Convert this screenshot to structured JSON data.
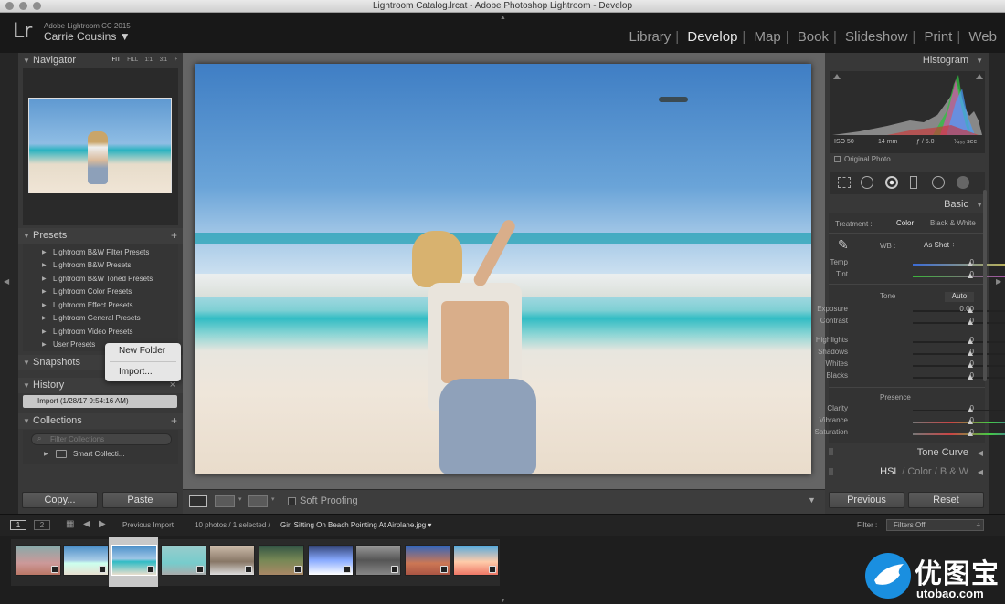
{
  "window": {
    "title": "Lightroom Catalog.lrcat - Adobe Photoshop Lightroom - Develop"
  },
  "identity": {
    "logo": "Lr",
    "product": "Adobe Lightroom CC 2015",
    "user": "Carrie Cousins ▼"
  },
  "modules": [
    "Library",
    "Develop",
    "Map",
    "Book",
    "Slideshow",
    "Print",
    "Web"
  ],
  "active_module": "Develop",
  "navigator": {
    "title": "Navigator",
    "zoom": [
      "FIT",
      "FILL",
      "1:1",
      "3:1 ÷"
    ]
  },
  "presets": {
    "title": "Presets",
    "add": "+",
    "items": [
      "Lightroom B&W Filter Presets",
      "Lightroom B&W Presets",
      "Lightroom B&W Toned Presets",
      "Lightroom Color Presets",
      "Lightroom Effect Presets",
      "Lightroom General Presets",
      "Lightroom Video Presets",
      "User Presets"
    ]
  },
  "context_menu": {
    "items": [
      "New Folder",
      "Import..."
    ]
  },
  "snapshots": {
    "title": "Snapshots"
  },
  "history": {
    "title": "History",
    "close": "×",
    "items": [
      "Import (1/28/17 9:54:16 AM)"
    ]
  },
  "collections": {
    "title": "Collections",
    "add": "+",
    "search_placeholder": "Filter Collections",
    "items": [
      "Smart Collecti..."
    ]
  },
  "left_buttons": {
    "copy": "Copy...",
    "paste": "Paste"
  },
  "histogram": {
    "title": "Histogram",
    "iso": "ISO 50",
    "focal": "14 mm",
    "aperture": "ƒ / 5.0",
    "shutter": "¹⁄₄₀₀ sec",
    "original_photo": "Original Photo"
  },
  "basic": {
    "title": "Basic",
    "treatment_label": "Treatment :",
    "treatment_color": "Color",
    "treatment_bw": "Black & White",
    "wb_label": "WB :",
    "wb_value": "As Shot ÷",
    "tone_label": "Tone",
    "auto": "Auto",
    "presence_label": "Presence",
    "wb_sliders": [
      {
        "name": "Temp",
        "value": "0",
        "pos": 0.5
      },
      {
        "name": "Tint",
        "value": "0",
        "pos": 0.5
      }
    ],
    "tone_sliders": [
      {
        "name": "Exposure",
        "value": "0.00",
        "pos": 0.5
      },
      {
        "name": "Contrast",
        "value": "0",
        "pos": 0.5
      }
    ],
    "tone_sliders2": [
      {
        "name": "Highlights",
        "value": "0",
        "pos": 0.5
      },
      {
        "name": "Shadows",
        "value": "0",
        "pos": 0.5
      },
      {
        "name": "Whites",
        "value": "0",
        "pos": 0.5
      },
      {
        "name": "Blacks",
        "value": "0",
        "pos": 0.5
      }
    ],
    "presence_sliders": [
      {
        "name": "Clarity",
        "value": "0",
        "pos": 0.5
      },
      {
        "name": "Vibrance",
        "value": "0",
        "pos": 0.5
      },
      {
        "name": "Saturation",
        "value": "0",
        "pos": 0.5
      }
    ]
  },
  "tone_curve": {
    "title": "Tone Curve"
  },
  "hsl": {
    "hsl": "HSL",
    "color": "Color",
    "bw": "B & W",
    "sep": "/"
  },
  "right_buttons": {
    "previous": "Previous",
    "reset": "Reset"
  },
  "toolbar": {
    "soft_proofing": "Soft Proofing"
  },
  "filmstrip": {
    "screen1": "1",
    "screen2": "2",
    "source": "Previous Import",
    "count": "10 photos / 1 selected /",
    "filename": "Girl Sitting On Beach Pointing At Airplane.jpg ▾",
    "filter_label": "Filter :",
    "filter_value": "Filters Off"
  },
  "watermark": {
    "brand": "优图宝",
    "url": "utobao.com"
  }
}
